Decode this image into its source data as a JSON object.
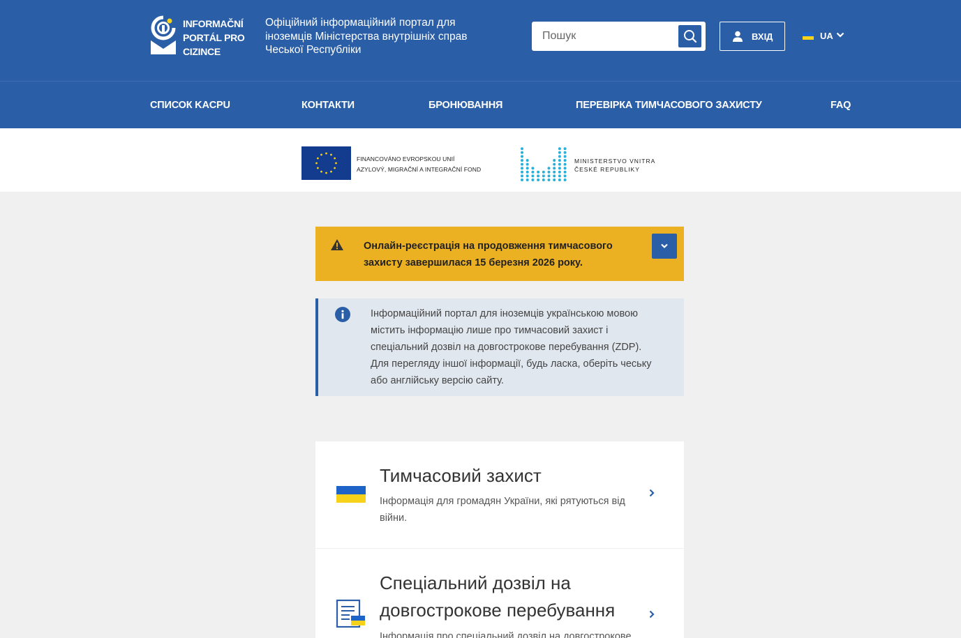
{
  "header": {
    "logo_lines": [
      "INFORMAČNÍ",
      "PORTÁL PRO",
      "CIZINCE"
    ],
    "tagline": "Офіційний інформаційний портал для іноземців Міністерства внутрішніх справ Чеської Республіки",
    "search_placeholder": "Пошук",
    "login_label": "ВХІД",
    "language": "UA",
    "icons": {
      "logo": "info-i-logo",
      "search": "search-icon",
      "login": "user-icon",
      "language_flag": "ukraine-flag-icon",
      "language_dropdown": "chevron-down-icon"
    }
  },
  "nav": {
    "items": [
      "СПИСОК KACPU",
      "КОНТАКТИ",
      "БРОНЮВАННЯ",
      "ПЕРЕВІРКА ТИМЧАСОВОГО ЗАХИСТУ",
      "FAQ"
    ]
  },
  "funding": {
    "eu_lines": [
      "FINANCOVÁNO EVROPSKOU UNIÍ",
      "AZYLOVÝ, MIGRAČNÍ A INTEGRAČNÍ FOND"
    ],
    "ministry_lines": [
      "MINISTERSTVO VNITRA",
      "ČESKÉ REPUBLIKY"
    ]
  },
  "alert": {
    "text": "Онлайн-реєстрація на продовження тимчасового захисту завершилася 15 березня 2026 року.",
    "icon": "warning-icon",
    "toggle_icon": "chevron-down-icon",
    "background_color": "#ecb023"
  },
  "info": {
    "text": "Інформаційний портал для іноземців українською мовою містить інформацію лише про тимчасовий захист і спеціальний дозвіл на довгострокове перебування (ZDP). Для перегляду іншої інформації, будь ласка, оберіть чеську або англійську версію сайту.",
    "icon": "info-icon"
  },
  "cards": [
    {
      "title": "Тимчасовий захист",
      "description": "Інформація для громадян України, які рятуються від війни.",
      "icon": "ukraine-flag-icon"
    },
    {
      "title": "Спеціальний дозвіл на довгострокове перебування",
      "description": "Інформація про спеціальний дозвіл на довгострокове",
      "icon": "document-icon"
    }
  ],
  "colors": {
    "brand_blue": "#2a5ea7",
    "alert_yellow": "#ecb023",
    "info_background": "#e1e7ee",
    "page_background": "#f0f0f0"
  }
}
